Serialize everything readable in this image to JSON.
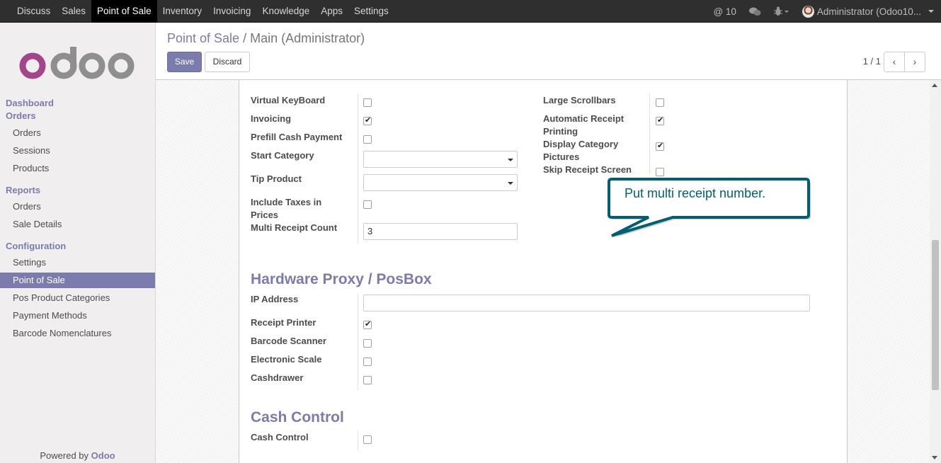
{
  "topbar": {
    "menu": [
      "Discuss",
      "Sales",
      "Point of Sale",
      "Inventory",
      "Invoicing",
      "Knowledge",
      "Apps",
      "Settings"
    ],
    "active_index": 2,
    "mentions_count": "@ 10",
    "user": "Administrator (Odoo10..."
  },
  "sidebar": {
    "dashboard": "Dashboard",
    "orders_section": "Orders",
    "orders_items": [
      "Orders",
      "Sessions",
      "Products"
    ],
    "reports_section": "Reports",
    "reports_items": [
      "Orders",
      "Sale Details"
    ],
    "config_section": "Configuration",
    "config_items": [
      "Settings",
      "Point of Sale",
      "Pos Product Categories",
      "Payment Methods",
      "Barcode Nomenclatures"
    ],
    "active_item": "Point of Sale",
    "powered_prefix": "Powered by",
    "powered_brand": "Odoo"
  },
  "control_panel": {
    "breadcrumb_link": "Point of Sale",
    "breadcrumb_sep": "/",
    "breadcrumb_current": "Main (Administrator)",
    "save_label": "Save",
    "discard_label": "Discard",
    "pager": "1 / 1"
  },
  "form": {
    "left_fields": [
      {
        "label": "Virtual KeyBoard",
        "checked": false
      },
      {
        "label": "Invoicing",
        "checked": true
      },
      {
        "label": "Prefill Cash Payment",
        "checked": false
      },
      {
        "label": "Start Category",
        "value": ""
      },
      {
        "label": "Tip Product",
        "value": ""
      },
      {
        "label": "Include Taxes in Prices",
        "checked": false
      },
      {
        "label": "Multi Receipt Count",
        "value": "3"
      }
    ],
    "right_fields": [
      {
        "label": "Large Scrollbars",
        "checked": false
      },
      {
        "label": "Automatic Receipt Printing",
        "checked": true
      },
      {
        "label": "Display Category Pictures",
        "checked": true
      },
      {
        "label": "Skip Receipt Screen",
        "checked": false
      }
    ],
    "hardware_title": "Hardware Proxy / PosBox",
    "hardware_fields": [
      {
        "label": "IP Address",
        "value": ""
      },
      {
        "label": "Receipt Printer",
        "checked": true
      },
      {
        "label": "Barcode Scanner",
        "checked": false
      },
      {
        "label": "Electronic Scale",
        "checked": false
      },
      {
        "label": "Cashdrawer",
        "checked": false
      }
    ],
    "cash_title": "Cash Control",
    "cash_fields": [
      {
        "label": "Cash Control",
        "checked": false
      }
    ]
  },
  "callout": {
    "text": "Put multi receipt number.",
    "color": "#005f73"
  },
  "colors": {
    "accent": "#7c7bad",
    "topbar": "#2f2f2f"
  }
}
